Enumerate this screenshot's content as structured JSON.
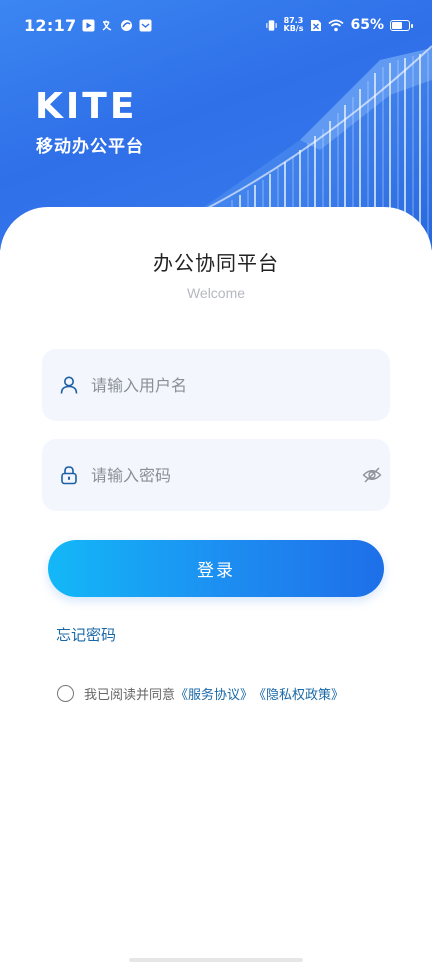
{
  "status_bar": {
    "time": "12:17",
    "net_speed_value": "87.3",
    "net_speed_unit": "KB/s",
    "battery_text": "65%",
    "battery_level": 0.65
  },
  "brand": {
    "logo_text": "KITE",
    "subtitle": "移动办公平台"
  },
  "login": {
    "title": "办公协同平台",
    "subtitle": "Welcome",
    "username_placeholder": "请输入用户名",
    "password_placeholder": "请输入密码",
    "submit_label": "登录",
    "forgot_password": "忘记密码",
    "agreement_prefix": "我已阅读并同意",
    "terms_link": "《服务协议》",
    "privacy_link": "《隐私权政策》"
  },
  "colors": {
    "hero_blue": "#2f6fe8",
    "button_gradient_start": "#13b8f7",
    "button_gradient_end": "#1e6fe8",
    "link_blue": "#1868a8",
    "field_bg": "#f3f7fd"
  }
}
